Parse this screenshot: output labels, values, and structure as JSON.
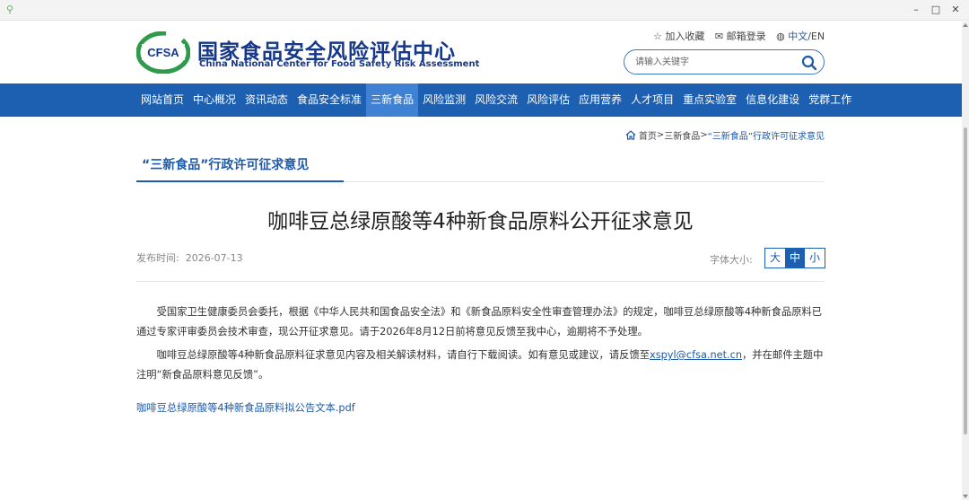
{
  "header": {
    "logo_text": "CFSA",
    "name_cn": "国家食品安全风险评估中心",
    "name_en": "China National Center for Food Safety Risk Assessment",
    "links": {
      "favorite": "加入收藏",
      "mail": "邮箱登录",
      "lang_cn": "中文",
      "lang_sep": " / ",
      "lang_en": "EN"
    },
    "search_placeholder": "请输入关键字"
  },
  "nav": {
    "items": [
      {
        "label": "网站首页"
      },
      {
        "label": "中心概况"
      },
      {
        "label": "资讯动态"
      },
      {
        "label": "食品安全标准"
      },
      {
        "label": "三新食品"
      },
      {
        "label": "风险监测"
      },
      {
        "label": "风险交流"
      },
      {
        "label": "风险评估"
      },
      {
        "label": "应用营养"
      },
      {
        "label": "人才项目"
      },
      {
        "label": "重点实验室"
      },
      {
        "label": "信息化建设"
      },
      {
        "label": "党群工作"
      }
    ],
    "active_index": 4
  },
  "breadcrumb": {
    "home": "首页",
    "sep": " > ",
    "level1": "三新食品",
    "level2": "“三新食品”行政许可征求意见"
  },
  "section_title": "“三新食品”行政许可征求意见",
  "article": {
    "title": "咖啡豆总绿原酸等4种新食品原料公开征求意见",
    "publish_label": "发布时间:",
    "publish_date": "2026-07-13",
    "font_size_label": "字体大小:",
    "font_sizes": {
      "large": "大",
      "medium": "中",
      "small": "小"
    },
    "paragraph1": "受国家卫生健康委员会委托，根据《中华人民共和国食品安全法》和《新食品原料安全性审查管理办法》的规定，咖啡豆总绿原酸等4种新食品原料已通过专家评审委员会技术审查，现公开征求意见。请于2026年8月12日前将意见反馈至我中心，逾期将不予处理。",
    "paragraph2_before": "咖啡豆总绿原酸等4种新食品原料征求意见内容及相关解读材料，请自行下载阅读。如有意见或建议，请反馈至",
    "email": "xspyl@cfsa.net.cn",
    "paragraph2_after": "，并在邮件主题中注明“新食品原料意见反馈”。",
    "attachment": "咖啡豆总绿原酸等4种新食品原料拟公告文本.pdf"
  },
  "colors": {
    "primary": "#1d5fb0",
    "nav_active": "#3f82d3",
    "link": "#1d5aa8",
    "logo_green": "#2e9b4b"
  }
}
